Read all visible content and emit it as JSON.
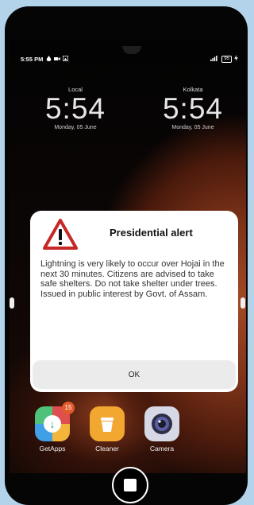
{
  "status_bar": {
    "time": "5:55 PM",
    "battery": "95"
  },
  "clocks": [
    {
      "label": "Local",
      "time": "5:54",
      "date": "Monday, 05 June"
    },
    {
      "label": "Kolkata",
      "time": "5:54",
      "date": "Monday, 05 June"
    }
  ],
  "alert": {
    "icon": "warning-triangle-icon",
    "title": "Presidential alert",
    "body": "Lightning is very likely to occur over Hojai in the next 30 minutes. Citizens are advised to take safe shelters. Do not take shelter under trees. Issued in public interest by Govt. of Assam.",
    "ok_label": "OK"
  },
  "apps": [
    {
      "name": "GetApps",
      "badge": "15",
      "icon": "getapps-icon"
    },
    {
      "name": "Cleaner",
      "icon": "trash-icon"
    },
    {
      "name": "Camera",
      "icon": "camera-icon"
    }
  ],
  "colors": {
    "background": "#b3d3ea",
    "alert_red": "#c62828",
    "badge": "#e35a2b"
  }
}
